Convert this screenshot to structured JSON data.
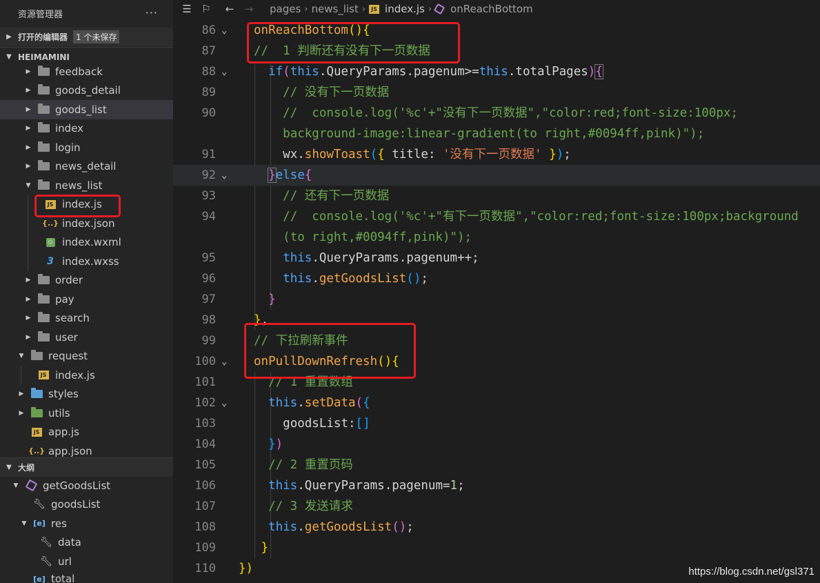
{
  "sidebar": {
    "title": "资源管理器",
    "more": "···",
    "open_editors": {
      "label": "打开的编辑器",
      "badge": "1 个未保存"
    },
    "project": {
      "label": "HEIMAMINI"
    },
    "tree": [
      {
        "label": "feedback",
        "icon": "folder-icon"
      },
      {
        "label": "goods_detail",
        "icon": "folder-icon"
      },
      {
        "label": "goods_list",
        "icon": "folder-icon"
      },
      {
        "label": "index",
        "icon": "folder-icon"
      },
      {
        "label": "login",
        "icon": "folder-icon"
      },
      {
        "label": "news_detail",
        "icon": "folder-icon"
      },
      {
        "label": "news_list",
        "icon": "folder-open-icon"
      },
      {
        "label": "index.js",
        "icon": "js-file-icon"
      },
      {
        "label": "index.json",
        "icon": "json-file-icon"
      },
      {
        "label": "index.wxml",
        "icon": "wxml-file-icon"
      },
      {
        "label": "index.wxss",
        "icon": "css-file-icon"
      },
      {
        "label": "order",
        "icon": "folder-icon"
      },
      {
        "label": "pay",
        "icon": "folder-icon"
      },
      {
        "label": "search",
        "icon": "folder-icon"
      },
      {
        "label": "user",
        "icon": "folder-icon"
      },
      {
        "label": "request",
        "icon": "folder-open-icon"
      },
      {
        "label": "index.js",
        "icon": "js-file-icon"
      },
      {
        "label": "styles",
        "icon": "folder-blue-icon"
      },
      {
        "label": "utils",
        "icon": "folder-green-icon"
      },
      {
        "label": "app.js",
        "icon": "js-file-icon"
      },
      {
        "label": "app.json",
        "icon": "json-file-icon"
      }
    ],
    "outline": {
      "label": "大纲",
      "items": [
        {
          "label": "getGoodsList",
          "icon": "method-cube-icon"
        },
        {
          "label": "goodsList",
          "icon": "wrench-icon"
        },
        {
          "label": "res",
          "icon": "variable-bracket-icon"
        },
        {
          "label": "data",
          "icon": "wrench-icon"
        },
        {
          "label": "url",
          "icon": "wrench-icon"
        },
        {
          "label": "total",
          "icon": "variable-bracket-icon"
        }
      ]
    }
  },
  "breadcrumb": {
    "items": [
      "pages",
      "news_list",
      "index.js",
      "onReachBottom"
    ]
  },
  "code": {
    "lines": [
      {
        "num": "86",
        "fold": true
      },
      {
        "num": "87"
      },
      {
        "num": "88",
        "fold": true
      },
      {
        "num": "89"
      },
      {
        "num": "90"
      },
      {
        "num": ""
      },
      {
        "num": "91"
      },
      {
        "num": "92",
        "fold": true
      },
      {
        "num": "93"
      },
      {
        "num": "94"
      },
      {
        "num": ""
      },
      {
        "num": "95"
      },
      {
        "num": "96"
      },
      {
        "num": "97"
      },
      {
        "num": "98"
      },
      {
        "num": "99"
      },
      {
        "num": "100",
        "fold": true
      },
      {
        "num": "101"
      },
      {
        "num": "102",
        "fold": true
      },
      {
        "num": "103"
      },
      {
        "num": "104"
      },
      {
        "num": "105"
      },
      {
        "num": "106"
      },
      {
        "num": "107"
      },
      {
        "num": "108"
      },
      {
        "num": "109"
      },
      {
        "num": "110"
      }
    ],
    "t": {
      "fn_onReachBottom": "onReachBottom",
      "c_87": "//  1 判断还有没有下一页数据",
      "kw_this": "this",
      "p_queryparams": "QueryParams",
      "p_pagenum": "pagenum",
      "p_totalPages": "totalPages",
      "kw_if": "if",
      "c_89": "// 没有下一页数据",
      "c_90a": "//  console.log('%c'+\"没有下一页数据\",\"color:red;font-size:100px;",
      "c_90b": "background-image:linear-gradient(to right,#0094ff,pink)\");",
      "wx": "wx",
      "fn_showToast": "showToast",
      "title_key": "title",
      "title_val": "'没有下一页数据'",
      "kw_else": "else",
      "c_93": "// 还有下一页数据",
      "c_94a": "//  console.log('%c'+\"有下一页数据\",\"color:red;font-size:100px;background",
      "c_94b": "(to right,#0094ff,pink)\");",
      "fn_getGoodsList": "getGoodsList",
      "c_99": "// 下拉刷新事件",
      "fn_onPullDownRefresh": "onPullDownRefresh",
      "c_101": "// 1 重置数组",
      "fn_setData": "setData",
      "goodsList": "goodsList",
      "c_105": "// 2 重置页码",
      "c_107": "// 3 发送请求",
      "one": "1"
    }
  },
  "watermark": "https://blog.csdn.net/gsl371",
  "colors": {
    "highlight_box": "#e51c23",
    "comment": "#6aa84f",
    "function": "#f0a74a",
    "keyword": "#4fa3f6"
  }
}
